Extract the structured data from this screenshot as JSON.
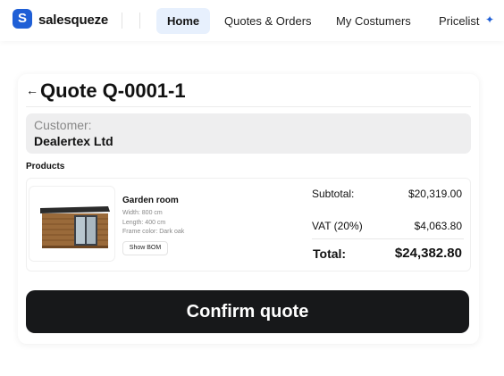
{
  "nav": {
    "brand": "salesqueze",
    "logo_letter": "S",
    "items": [
      {
        "label": "Home",
        "active": true
      },
      {
        "label": "Quotes & Orders",
        "active": false
      },
      {
        "label": "My Costumers",
        "active": false
      },
      {
        "label": "Pricelist",
        "active": false
      }
    ],
    "accent_color": "#1f5fd6"
  },
  "quote": {
    "title": "Quote Q-0001-1",
    "customer_label": "Customer:",
    "customer_name": "Dealertex Ltd",
    "products_label": "Products",
    "product": {
      "name": "Garden room",
      "width": "Width: 800 cm",
      "length": "Length: 400 cm",
      "frame_color": "Frame color: Dark oak",
      "bom_button": "Show BOM"
    },
    "summary": {
      "subtotal_label": "Subtotal:",
      "subtotal_value": "$20,319.00",
      "vat_label": "VAT (20%)",
      "vat_value": "$4,063.80",
      "total_label": "Total:",
      "total_value": "$24,382.80"
    },
    "confirm_label": "Confirm quote"
  }
}
